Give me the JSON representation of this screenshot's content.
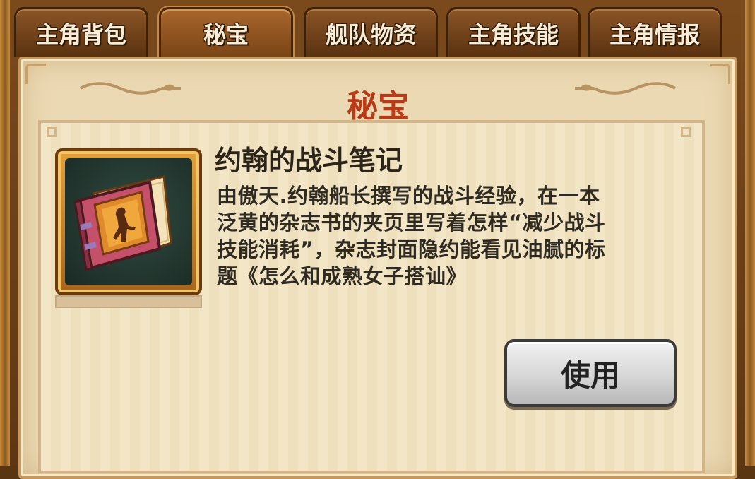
{
  "tabs": [
    {
      "label": "主角背包"
    },
    {
      "label": "秘宝"
    },
    {
      "label": "舰队物资"
    },
    {
      "label": "主角技能"
    },
    {
      "label": "主角情报"
    }
  ],
  "active_tab": "秘宝",
  "panel": {
    "title": "秘宝"
  },
  "item": {
    "name": "约翰的战斗笔记",
    "icon": "book-icon",
    "description_lines": [
      "由傲天.约翰船长撰写的战斗经验，在一本",
      "泛黄的杂志书的夹页里写着怎样“减少战斗",
      "技能消耗”，杂志封面隐约能看见油腻的标",
      "题《怎么和成熟女子搭讪》"
    ]
  },
  "actions": {
    "use_label": "使用"
  },
  "colors": {
    "title_red": "#b83a18",
    "parchment": "#ebd9b3",
    "tab_brown": "#8a5526"
  }
}
